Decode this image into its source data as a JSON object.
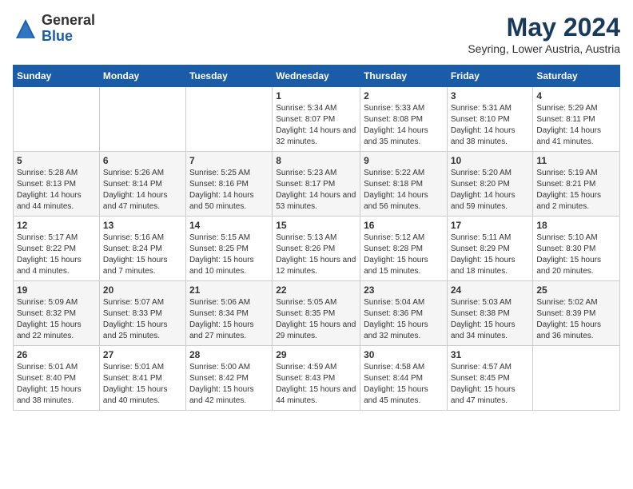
{
  "logo": {
    "general": "General",
    "blue": "Blue"
  },
  "title": {
    "month_year": "May 2024",
    "location": "Seyring, Lower Austria, Austria"
  },
  "days_of_week": [
    "Sunday",
    "Monday",
    "Tuesday",
    "Wednesday",
    "Thursday",
    "Friday",
    "Saturday"
  ],
  "weeks": [
    [
      {
        "day": "",
        "sunrise": "",
        "sunset": "",
        "daylight": ""
      },
      {
        "day": "",
        "sunrise": "",
        "sunset": "",
        "daylight": ""
      },
      {
        "day": "",
        "sunrise": "",
        "sunset": "",
        "daylight": ""
      },
      {
        "day": "1",
        "sunrise": "Sunrise: 5:34 AM",
        "sunset": "Sunset: 8:07 PM",
        "daylight": "Daylight: 14 hours and 32 minutes."
      },
      {
        "day": "2",
        "sunrise": "Sunrise: 5:33 AM",
        "sunset": "Sunset: 8:08 PM",
        "daylight": "Daylight: 14 hours and 35 minutes."
      },
      {
        "day": "3",
        "sunrise": "Sunrise: 5:31 AM",
        "sunset": "Sunset: 8:10 PM",
        "daylight": "Daylight: 14 hours and 38 minutes."
      },
      {
        "day": "4",
        "sunrise": "Sunrise: 5:29 AM",
        "sunset": "Sunset: 8:11 PM",
        "daylight": "Daylight: 14 hours and 41 minutes."
      }
    ],
    [
      {
        "day": "5",
        "sunrise": "Sunrise: 5:28 AM",
        "sunset": "Sunset: 8:13 PM",
        "daylight": "Daylight: 14 hours and 44 minutes."
      },
      {
        "day": "6",
        "sunrise": "Sunrise: 5:26 AM",
        "sunset": "Sunset: 8:14 PM",
        "daylight": "Daylight: 14 hours and 47 minutes."
      },
      {
        "day": "7",
        "sunrise": "Sunrise: 5:25 AM",
        "sunset": "Sunset: 8:16 PM",
        "daylight": "Daylight: 14 hours and 50 minutes."
      },
      {
        "day": "8",
        "sunrise": "Sunrise: 5:23 AM",
        "sunset": "Sunset: 8:17 PM",
        "daylight": "Daylight: 14 hours and 53 minutes."
      },
      {
        "day": "9",
        "sunrise": "Sunrise: 5:22 AM",
        "sunset": "Sunset: 8:18 PM",
        "daylight": "Daylight: 14 hours and 56 minutes."
      },
      {
        "day": "10",
        "sunrise": "Sunrise: 5:20 AM",
        "sunset": "Sunset: 8:20 PM",
        "daylight": "Daylight: 14 hours and 59 minutes."
      },
      {
        "day": "11",
        "sunrise": "Sunrise: 5:19 AM",
        "sunset": "Sunset: 8:21 PM",
        "daylight": "Daylight: 15 hours and 2 minutes."
      }
    ],
    [
      {
        "day": "12",
        "sunrise": "Sunrise: 5:17 AM",
        "sunset": "Sunset: 8:22 PM",
        "daylight": "Daylight: 15 hours and 4 minutes."
      },
      {
        "day": "13",
        "sunrise": "Sunrise: 5:16 AM",
        "sunset": "Sunset: 8:24 PM",
        "daylight": "Daylight: 15 hours and 7 minutes."
      },
      {
        "day": "14",
        "sunrise": "Sunrise: 5:15 AM",
        "sunset": "Sunset: 8:25 PM",
        "daylight": "Daylight: 15 hours and 10 minutes."
      },
      {
        "day": "15",
        "sunrise": "Sunrise: 5:13 AM",
        "sunset": "Sunset: 8:26 PM",
        "daylight": "Daylight: 15 hours and 12 minutes."
      },
      {
        "day": "16",
        "sunrise": "Sunrise: 5:12 AM",
        "sunset": "Sunset: 8:28 PM",
        "daylight": "Daylight: 15 hours and 15 minutes."
      },
      {
        "day": "17",
        "sunrise": "Sunrise: 5:11 AM",
        "sunset": "Sunset: 8:29 PM",
        "daylight": "Daylight: 15 hours and 18 minutes."
      },
      {
        "day": "18",
        "sunrise": "Sunrise: 5:10 AM",
        "sunset": "Sunset: 8:30 PM",
        "daylight": "Daylight: 15 hours and 20 minutes."
      }
    ],
    [
      {
        "day": "19",
        "sunrise": "Sunrise: 5:09 AM",
        "sunset": "Sunset: 8:32 PM",
        "daylight": "Daylight: 15 hours and 22 minutes."
      },
      {
        "day": "20",
        "sunrise": "Sunrise: 5:07 AM",
        "sunset": "Sunset: 8:33 PM",
        "daylight": "Daylight: 15 hours and 25 minutes."
      },
      {
        "day": "21",
        "sunrise": "Sunrise: 5:06 AM",
        "sunset": "Sunset: 8:34 PM",
        "daylight": "Daylight: 15 hours and 27 minutes."
      },
      {
        "day": "22",
        "sunrise": "Sunrise: 5:05 AM",
        "sunset": "Sunset: 8:35 PM",
        "daylight": "Daylight: 15 hours and 29 minutes."
      },
      {
        "day": "23",
        "sunrise": "Sunrise: 5:04 AM",
        "sunset": "Sunset: 8:36 PM",
        "daylight": "Daylight: 15 hours and 32 minutes."
      },
      {
        "day": "24",
        "sunrise": "Sunrise: 5:03 AM",
        "sunset": "Sunset: 8:38 PM",
        "daylight": "Daylight: 15 hours and 34 minutes."
      },
      {
        "day": "25",
        "sunrise": "Sunrise: 5:02 AM",
        "sunset": "Sunset: 8:39 PM",
        "daylight": "Daylight: 15 hours and 36 minutes."
      }
    ],
    [
      {
        "day": "26",
        "sunrise": "Sunrise: 5:01 AM",
        "sunset": "Sunset: 8:40 PM",
        "daylight": "Daylight: 15 hours and 38 minutes."
      },
      {
        "day": "27",
        "sunrise": "Sunrise: 5:01 AM",
        "sunset": "Sunset: 8:41 PM",
        "daylight": "Daylight: 15 hours and 40 minutes."
      },
      {
        "day": "28",
        "sunrise": "Sunrise: 5:00 AM",
        "sunset": "Sunset: 8:42 PM",
        "daylight": "Daylight: 15 hours and 42 minutes."
      },
      {
        "day": "29",
        "sunrise": "Sunrise: 4:59 AM",
        "sunset": "Sunset: 8:43 PM",
        "daylight": "Daylight: 15 hours and 44 minutes."
      },
      {
        "day": "30",
        "sunrise": "Sunrise: 4:58 AM",
        "sunset": "Sunset: 8:44 PM",
        "daylight": "Daylight: 15 hours and 45 minutes."
      },
      {
        "day": "31",
        "sunrise": "Sunrise: 4:57 AM",
        "sunset": "Sunset: 8:45 PM",
        "daylight": "Daylight: 15 hours and 47 minutes."
      },
      {
        "day": "",
        "sunrise": "",
        "sunset": "",
        "daylight": ""
      }
    ]
  ]
}
